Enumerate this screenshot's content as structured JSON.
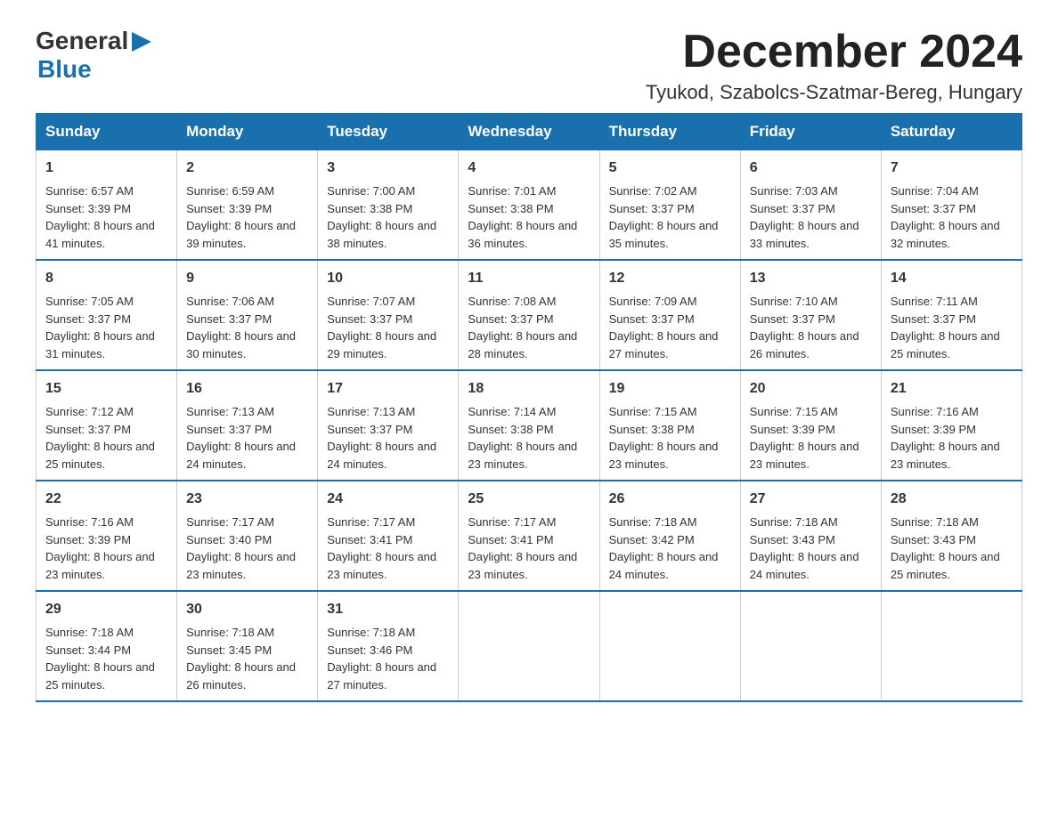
{
  "logo": {
    "general": "General",
    "blue": "Blue"
  },
  "title": "December 2024",
  "location": "Tyukod, Szabolcs-Szatmar-Bereg, Hungary",
  "days_of_week": [
    "Sunday",
    "Monday",
    "Tuesday",
    "Wednesday",
    "Thursday",
    "Friday",
    "Saturday"
  ],
  "weeks": [
    [
      {
        "day": "1",
        "sunrise": "6:57 AM",
        "sunset": "3:39 PM",
        "daylight": "8 hours and 41 minutes."
      },
      {
        "day": "2",
        "sunrise": "6:59 AM",
        "sunset": "3:39 PM",
        "daylight": "8 hours and 39 minutes."
      },
      {
        "day": "3",
        "sunrise": "7:00 AM",
        "sunset": "3:38 PM",
        "daylight": "8 hours and 38 minutes."
      },
      {
        "day": "4",
        "sunrise": "7:01 AM",
        "sunset": "3:38 PM",
        "daylight": "8 hours and 36 minutes."
      },
      {
        "day": "5",
        "sunrise": "7:02 AM",
        "sunset": "3:37 PM",
        "daylight": "8 hours and 35 minutes."
      },
      {
        "day": "6",
        "sunrise": "7:03 AM",
        "sunset": "3:37 PM",
        "daylight": "8 hours and 33 minutes."
      },
      {
        "day": "7",
        "sunrise": "7:04 AM",
        "sunset": "3:37 PM",
        "daylight": "8 hours and 32 minutes."
      }
    ],
    [
      {
        "day": "8",
        "sunrise": "7:05 AM",
        "sunset": "3:37 PM",
        "daylight": "8 hours and 31 minutes."
      },
      {
        "day": "9",
        "sunrise": "7:06 AM",
        "sunset": "3:37 PM",
        "daylight": "8 hours and 30 minutes."
      },
      {
        "day": "10",
        "sunrise": "7:07 AM",
        "sunset": "3:37 PM",
        "daylight": "8 hours and 29 minutes."
      },
      {
        "day": "11",
        "sunrise": "7:08 AM",
        "sunset": "3:37 PM",
        "daylight": "8 hours and 28 minutes."
      },
      {
        "day": "12",
        "sunrise": "7:09 AM",
        "sunset": "3:37 PM",
        "daylight": "8 hours and 27 minutes."
      },
      {
        "day": "13",
        "sunrise": "7:10 AM",
        "sunset": "3:37 PM",
        "daylight": "8 hours and 26 minutes."
      },
      {
        "day": "14",
        "sunrise": "7:11 AM",
        "sunset": "3:37 PM",
        "daylight": "8 hours and 25 minutes."
      }
    ],
    [
      {
        "day": "15",
        "sunrise": "7:12 AM",
        "sunset": "3:37 PM",
        "daylight": "8 hours and 25 minutes."
      },
      {
        "day": "16",
        "sunrise": "7:13 AM",
        "sunset": "3:37 PM",
        "daylight": "8 hours and 24 minutes."
      },
      {
        "day": "17",
        "sunrise": "7:13 AM",
        "sunset": "3:37 PM",
        "daylight": "8 hours and 24 minutes."
      },
      {
        "day": "18",
        "sunrise": "7:14 AM",
        "sunset": "3:38 PM",
        "daylight": "8 hours and 23 minutes."
      },
      {
        "day": "19",
        "sunrise": "7:15 AM",
        "sunset": "3:38 PM",
        "daylight": "8 hours and 23 minutes."
      },
      {
        "day": "20",
        "sunrise": "7:15 AM",
        "sunset": "3:39 PM",
        "daylight": "8 hours and 23 minutes."
      },
      {
        "day": "21",
        "sunrise": "7:16 AM",
        "sunset": "3:39 PM",
        "daylight": "8 hours and 23 minutes."
      }
    ],
    [
      {
        "day": "22",
        "sunrise": "7:16 AM",
        "sunset": "3:39 PM",
        "daylight": "8 hours and 23 minutes."
      },
      {
        "day": "23",
        "sunrise": "7:17 AM",
        "sunset": "3:40 PM",
        "daylight": "8 hours and 23 minutes."
      },
      {
        "day": "24",
        "sunrise": "7:17 AM",
        "sunset": "3:41 PM",
        "daylight": "8 hours and 23 minutes."
      },
      {
        "day": "25",
        "sunrise": "7:17 AM",
        "sunset": "3:41 PM",
        "daylight": "8 hours and 23 minutes."
      },
      {
        "day": "26",
        "sunrise": "7:18 AM",
        "sunset": "3:42 PM",
        "daylight": "8 hours and 24 minutes."
      },
      {
        "day": "27",
        "sunrise": "7:18 AM",
        "sunset": "3:43 PM",
        "daylight": "8 hours and 24 minutes."
      },
      {
        "day": "28",
        "sunrise": "7:18 AM",
        "sunset": "3:43 PM",
        "daylight": "8 hours and 25 minutes."
      }
    ],
    [
      {
        "day": "29",
        "sunrise": "7:18 AM",
        "sunset": "3:44 PM",
        "daylight": "8 hours and 25 minutes."
      },
      {
        "day": "30",
        "sunrise": "7:18 AM",
        "sunset": "3:45 PM",
        "daylight": "8 hours and 26 minutes."
      },
      {
        "day": "31",
        "sunrise": "7:18 AM",
        "sunset": "3:46 PM",
        "daylight": "8 hours and 27 minutes."
      },
      null,
      null,
      null,
      null
    ]
  ],
  "labels": {
    "sunrise": "Sunrise:",
    "sunset": "Sunset:",
    "daylight": "Daylight:"
  }
}
